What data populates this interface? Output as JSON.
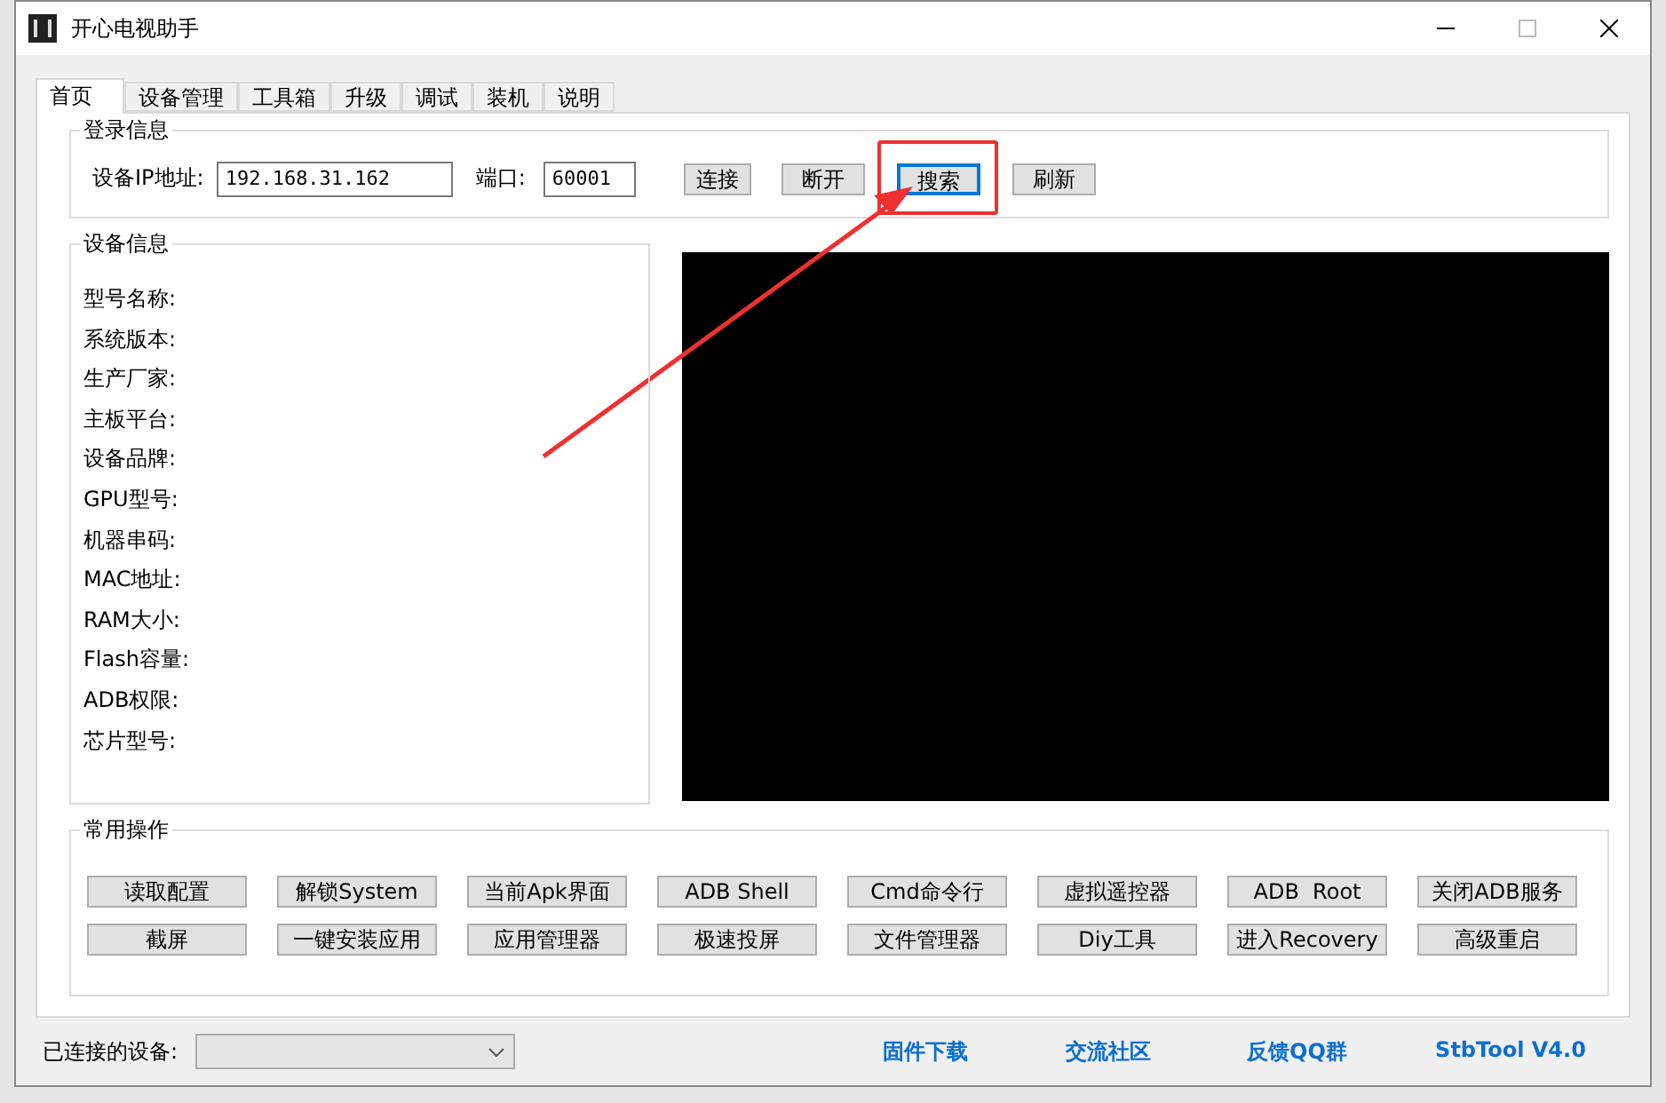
{
  "window": {
    "title": "开心电视助手"
  },
  "tabs": [
    {
      "label": "首页",
      "selected": true
    },
    {
      "label": "设备管理",
      "selected": false
    },
    {
      "label": "工具箱",
      "selected": false
    },
    {
      "label": "升级",
      "selected": false
    },
    {
      "label": "调试",
      "selected": false
    },
    {
      "label": "装机",
      "selected": false
    },
    {
      "label": "说明",
      "selected": false
    }
  ],
  "login": {
    "legend": "登录信息",
    "ip_label": "设备IP地址:",
    "ip_value": "192.168.31.162",
    "port_label": "端口:",
    "port_value": "60001",
    "buttons": [
      {
        "label": "连接",
        "focused": false,
        "highlighted": false
      },
      {
        "label": "断开",
        "focused": false,
        "highlighted": false
      },
      {
        "label": "搜索",
        "focused": true,
        "highlighted": true
      },
      {
        "label": "刷新",
        "focused": false,
        "highlighted": false
      }
    ]
  },
  "device_info": {
    "legend": "设备信息",
    "fields": [
      "型号名称:",
      "系统版本:",
      "生产厂家:",
      "主板平台:",
      "设备品牌:",
      "GPU型号:",
      "机器串码:",
      "MAC地址:",
      "RAM大小:",
      "Flash容量:",
      "ADB权限:",
      "芯片型号:"
    ]
  },
  "operations": {
    "legend": "常用操作",
    "buttons": [
      "读取配置",
      "解锁System",
      "当前Apk界面",
      "ADB Shell",
      "Cmd命令行",
      "虚拟遥控器",
      "ADB  Root",
      "关闭ADB服务",
      "截屏",
      "一键安装应用",
      "应用管理器",
      "极速投屏",
      "文件管理器",
      "Diy工具",
      "进入Recovery",
      "高级重启"
    ]
  },
  "status_bar": {
    "device_label": "已连接的设备:",
    "links": [
      "固件下载",
      "交流社区",
      "反馈QQ群",
      "StbTool V4.0"
    ]
  }
}
